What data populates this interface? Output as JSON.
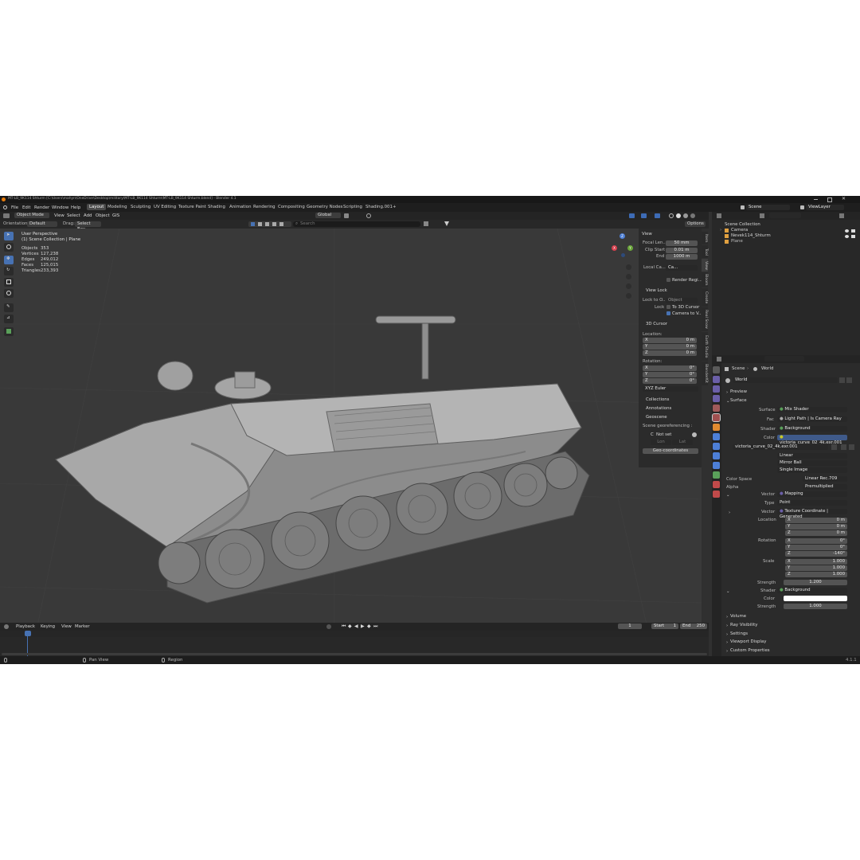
{
  "titlebar": {
    "title": "MT-LB_9K114 Shturm [C:\\Users\\mahyn\\OneDrive\\Desktop\\military\\MT-LB_9K114 Shturm\\MT-LB_9K114 Shturm.blend] - Blender 4.1"
  },
  "menu": {
    "items": [
      "File",
      "Edit",
      "Render",
      "Window",
      "Help"
    ]
  },
  "workspaces": [
    "Layout",
    "Modeling",
    "Sculpting",
    "UV Editing",
    "Texture Paint",
    "Shading",
    "Animation",
    "Rendering",
    "Compositing",
    "Geometry Nodes",
    "Scripting",
    "Shading.001"
  ],
  "add_tab": "+",
  "scene": {
    "label": "Scene",
    "viewlayer": "ViewLayer"
  },
  "header": {
    "mode": "Object Mode",
    "view": "View",
    "select": "Select",
    "add": "Add",
    "object": "Object",
    "gis": "GIS",
    "transform": "Global",
    "orientation_label": "Orientation:",
    "orientation_value": "Default",
    "drag_label": "Drag:",
    "drag_value": "Select Box",
    "options": "Options",
    "search_placeholder": "Search"
  },
  "overlay_info": {
    "perspective": "User Perspective",
    "collection": "(1) Scene Collection | Plane",
    "stats": [
      {
        "k": "Objects",
        "v": "353"
      },
      {
        "k": "Vertices",
        "v": "127,238"
      },
      {
        "k": "Edges",
        "v": "249,012"
      },
      {
        "k": "Faces",
        "v": "125,015"
      },
      {
        "k": "Triangles",
        "v": "233,393"
      }
    ]
  },
  "nav_gizmo": {
    "x": "X",
    "y": "Y",
    "z": "Z"
  },
  "n_panel": {
    "view_head": "View",
    "focal_label": "Focal Len...",
    "focal_value": "50 mm",
    "clip_start_label": "Clip Start",
    "clip_start_value": "0.01 m",
    "end_label": "End",
    "end_value": "1000 m",
    "local_cam_label": "Local Ca...",
    "local_cam_value": "Ca...",
    "render_region": "Render Regi...",
    "view_lock_head": "View Lock",
    "lock_obj_label": "Lock to O...",
    "lock_obj_value": "Object",
    "lock_label": "Lock",
    "lock_cursor": "To 3D Cursor",
    "camera_view": "Camera to V...",
    "cursor_head": "3D Cursor",
    "location_label": "Location:",
    "rotation_label": "Rotation:",
    "loc": [
      {
        "axis": "X",
        "val": "0 m"
      },
      {
        "axis": "Y",
        "val": "0 m"
      },
      {
        "axis": "Z",
        "val": "0 m"
      }
    ],
    "rot": [
      {
        "axis": "X",
        "val": "0°"
      },
      {
        "axis": "Y",
        "val": "0°"
      },
      {
        "axis": "Z",
        "val": "0°"
      }
    ],
    "euler": "XYZ Euler",
    "collections": "Collections",
    "annotations": "Annotations",
    "geoscene": "Geoscene",
    "geo_ref": "Scene georeferencing :",
    "crs_label": "C",
    "not_set": "Not set",
    "lon": "Lon",
    "lat": "Lat",
    "geo_coords": "Geo-coordinates"
  },
  "side_tabs": [
    "Item",
    "Tool",
    "View",
    "Bloom",
    "Create",
    "Real Snow",
    "Earth Studio",
    "BlenderKit"
  ],
  "outliner": {
    "root": "Scene Collection",
    "items": [
      "Camera",
      "Nevek114_Shturm",
      "Plane"
    ]
  },
  "properties": {
    "breadcrumb_scene": "Scene",
    "breadcrumb_world": "World",
    "world_name": "World",
    "preview": "Preview",
    "surface_head": "Surface",
    "surface_label": "Surface",
    "surface_value": "Mix Shader",
    "fac_label": "Fac",
    "fac_value": "Light Path | Is Camera Ray",
    "shader_label": "Shader",
    "shader_value": "Background",
    "color_label": "Color",
    "color_value": "victoria_curve_02_4k.exr.001",
    "image_name": "victoria_curve_02_4k.exr.001",
    "interp": "Linear",
    "projection": "Mirror Ball",
    "source": "Single Image",
    "colorspace_label": "Color Space",
    "colorspace_value": "Linear Rec.709",
    "alpha_label": "Alpha",
    "alpha_value": "Premultiplied",
    "vector_label": "Vector",
    "vector_value": "Mapping",
    "type_label": "Type",
    "type_value": "Point",
    "vector2_label": "Vector",
    "vector2_value": "Texture Coordinate | Generated",
    "location_label": "Location",
    "rotation_label": "Rotation",
    "scale_label": "Scale",
    "loc": [
      {
        "axis": "X",
        "val": "0 m"
      },
      {
        "axis": "Y",
        "val": "0 m"
      },
      {
        "axis": "Z",
        "val": "0 m"
      }
    ],
    "rot": [
      {
        "axis": "X",
        "val": "0°"
      },
      {
        "axis": "Y",
        "val": "0°"
      },
      {
        "axis": "Z",
        "val": "-140°"
      }
    ],
    "scale": [
      {
        "axis": "X",
        "val": "1.000"
      },
      {
        "axis": "Y",
        "val": "1.000"
      },
      {
        "axis": "Z",
        "val": "1.000"
      }
    ],
    "strength_label": "Strength",
    "strength_value": "1.200",
    "shader2_label": "Shader",
    "shader2_value": "Background",
    "color2_label": "Color",
    "strength2_label": "Strength",
    "strength2_value": "1.000",
    "panels": [
      "Volume",
      "Ray Visibility",
      "Settings",
      "Viewport Display",
      "Custom Properties"
    ]
  },
  "timeline": {
    "playback": "Playback",
    "keying": "Keying",
    "view": "View",
    "marker": "Marker",
    "current": "1",
    "start_label": "Start",
    "start": "1",
    "end_label": "End",
    "end": "250",
    "ticks": [
      "1",
      "10",
      "20",
      "30",
      "40",
      "50",
      "60",
      "70",
      "80",
      "90",
      "100",
      "110",
      "120",
      "130",
      "140",
      "150",
      "160",
      "170",
      "180",
      "190",
      "200",
      "210",
      "220",
      "230",
      "240",
      "250"
    ]
  },
  "statusbar": {
    "pan": "Pan View",
    "region": "Region",
    "version": "4.1.1"
  },
  "colors": {
    "accent": "#4772b3",
    "bg": "#303030",
    "panel": "#1d1d1d",
    "header": "#242424",
    "field": "#545454",
    "color_swatch": "#ffffff",
    "image_color_dot": "#c7c729"
  }
}
